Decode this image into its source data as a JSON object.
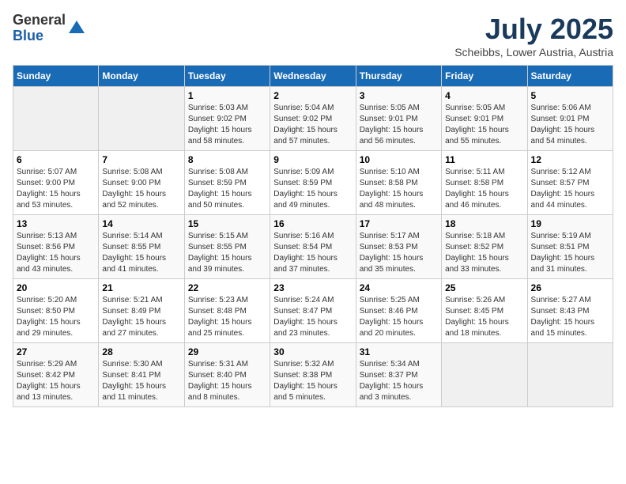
{
  "logo": {
    "general": "General",
    "blue": "Blue"
  },
  "header": {
    "month": "July 2025",
    "location": "Scheibbs, Lower Austria, Austria"
  },
  "weekdays": [
    "Sunday",
    "Monday",
    "Tuesday",
    "Wednesday",
    "Thursday",
    "Friday",
    "Saturday"
  ],
  "weeks": [
    [
      {
        "day": "",
        "info": ""
      },
      {
        "day": "",
        "info": ""
      },
      {
        "day": "1",
        "info": "Sunrise: 5:03 AM\nSunset: 9:02 PM\nDaylight: 15 hours\nand 58 minutes."
      },
      {
        "day": "2",
        "info": "Sunrise: 5:04 AM\nSunset: 9:02 PM\nDaylight: 15 hours\nand 57 minutes."
      },
      {
        "day": "3",
        "info": "Sunrise: 5:05 AM\nSunset: 9:01 PM\nDaylight: 15 hours\nand 56 minutes."
      },
      {
        "day": "4",
        "info": "Sunrise: 5:05 AM\nSunset: 9:01 PM\nDaylight: 15 hours\nand 55 minutes."
      },
      {
        "day": "5",
        "info": "Sunrise: 5:06 AM\nSunset: 9:01 PM\nDaylight: 15 hours\nand 54 minutes."
      }
    ],
    [
      {
        "day": "6",
        "info": "Sunrise: 5:07 AM\nSunset: 9:00 PM\nDaylight: 15 hours\nand 53 minutes."
      },
      {
        "day": "7",
        "info": "Sunrise: 5:08 AM\nSunset: 9:00 PM\nDaylight: 15 hours\nand 52 minutes."
      },
      {
        "day": "8",
        "info": "Sunrise: 5:08 AM\nSunset: 8:59 PM\nDaylight: 15 hours\nand 50 minutes."
      },
      {
        "day": "9",
        "info": "Sunrise: 5:09 AM\nSunset: 8:59 PM\nDaylight: 15 hours\nand 49 minutes."
      },
      {
        "day": "10",
        "info": "Sunrise: 5:10 AM\nSunset: 8:58 PM\nDaylight: 15 hours\nand 48 minutes."
      },
      {
        "day": "11",
        "info": "Sunrise: 5:11 AM\nSunset: 8:58 PM\nDaylight: 15 hours\nand 46 minutes."
      },
      {
        "day": "12",
        "info": "Sunrise: 5:12 AM\nSunset: 8:57 PM\nDaylight: 15 hours\nand 44 minutes."
      }
    ],
    [
      {
        "day": "13",
        "info": "Sunrise: 5:13 AM\nSunset: 8:56 PM\nDaylight: 15 hours\nand 43 minutes."
      },
      {
        "day": "14",
        "info": "Sunrise: 5:14 AM\nSunset: 8:55 PM\nDaylight: 15 hours\nand 41 minutes."
      },
      {
        "day": "15",
        "info": "Sunrise: 5:15 AM\nSunset: 8:55 PM\nDaylight: 15 hours\nand 39 minutes."
      },
      {
        "day": "16",
        "info": "Sunrise: 5:16 AM\nSunset: 8:54 PM\nDaylight: 15 hours\nand 37 minutes."
      },
      {
        "day": "17",
        "info": "Sunrise: 5:17 AM\nSunset: 8:53 PM\nDaylight: 15 hours\nand 35 minutes."
      },
      {
        "day": "18",
        "info": "Sunrise: 5:18 AM\nSunset: 8:52 PM\nDaylight: 15 hours\nand 33 minutes."
      },
      {
        "day": "19",
        "info": "Sunrise: 5:19 AM\nSunset: 8:51 PM\nDaylight: 15 hours\nand 31 minutes."
      }
    ],
    [
      {
        "day": "20",
        "info": "Sunrise: 5:20 AM\nSunset: 8:50 PM\nDaylight: 15 hours\nand 29 minutes."
      },
      {
        "day": "21",
        "info": "Sunrise: 5:21 AM\nSunset: 8:49 PM\nDaylight: 15 hours\nand 27 minutes."
      },
      {
        "day": "22",
        "info": "Sunrise: 5:23 AM\nSunset: 8:48 PM\nDaylight: 15 hours\nand 25 minutes."
      },
      {
        "day": "23",
        "info": "Sunrise: 5:24 AM\nSunset: 8:47 PM\nDaylight: 15 hours\nand 23 minutes."
      },
      {
        "day": "24",
        "info": "Sunrise: 5:25 AM\nSunset: 8:46 PM\nDaylight: 15 hours\nand 20 minutes."
      },
      {
        "day": "25",
        "info": "Sunrise: 5:26 AM\nSunset: 8:45 PM\nDaylight: 15 hours\nand 18 minutes."
      },
      {
        "day": "26",
        "info": "Sunrise: 5:27 AM\nSunset: 8:43 PM\nDaylight: 15 hours\nand 15 minutes."
      }
    ],
    [
      {
        "day": "27",
        "info": "Sunrise: 5:29 AM\nSunset: 8:42 PM\nDaylight: 15 hours\nand 13 minutes."
      },
      {
        "day": "28",
        "info": "Sunrise: 5:30 AM\nSunset: 8:41 PM\nDaylight: 15 hours\nand 11 minutes."
      },
      {
        "day": "29",
        "info": "Sunrise: 5:31 AM\nSunset: 8:40 PM\nDaylight: 15 hours\nand 8 minutes."
      },
      {
        "day": "30",
        "info": "Sunrise: 5:32 AM\nSunset: 8:38 PM\nDaylight: 15 hours\nand 5 minutes."
      },
      {
        "day": "31",
        "info": "Sunrise: 5:34 AM\nSunset: 8:37 PM\nDaylight: 15 hours\nand 3 minutes."
      },
      {
        "day": "",
        "info": ""
      },
      {
        "day": "",
        "info": ""
      }
    ]
  ]
}
